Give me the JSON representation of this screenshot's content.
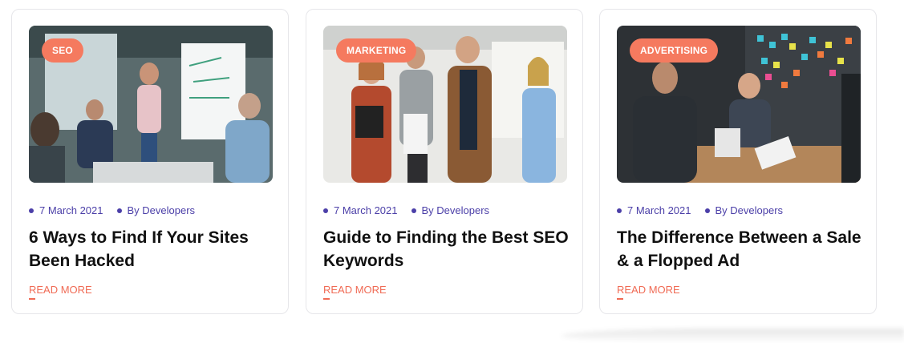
{
  "posts": [
    {
      "tag": "SEO",
      "date": "7 March 2021",
      "author": "By Developers",
      "title": "6 Ways to Find If Your Sites Been Hacked",
      "read_more": "READ MORE"
    },
    {
      "tag": "MARKETING",
      "date": "7 March 2021",
      "author": "By Developers",
      "title": "Guide to Finding the Best SEO Keywords",
      "read_more": "READ MORE"
    },
    {
      "tag": "ADVERTISING",
      "date": "7 March 2021",
      "author": "By Developers",
      "title": "The Difference Between a Sale & a Flopped Ad",
      "read_more": "READ MORE"
    }
  ],
  "colors": {
    "tag_bg": "#f57a5f",
    "meta": "#4b3fa8",
    "link": "#f06b55"
  }
}
